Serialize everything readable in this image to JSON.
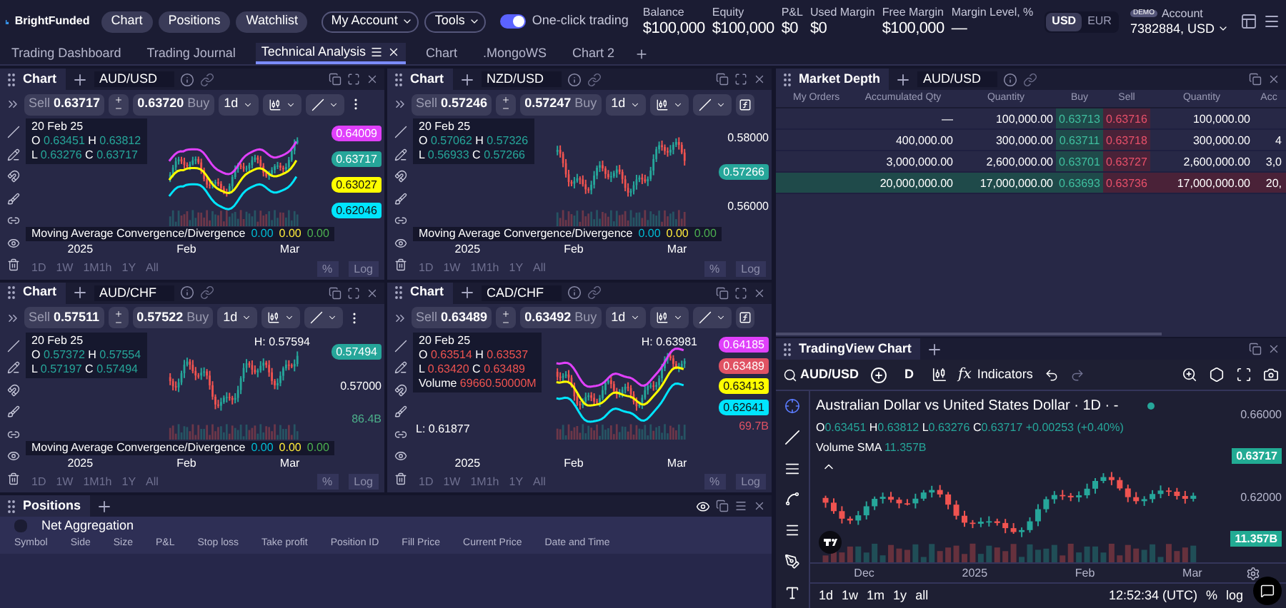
{
  "header": {
    "brand": "BrightFunded",
    "nav": [
      "Chart",
      "Positions",
      "Watchlist"
    ],
    "menus": [
      "My Account",
      "Tools"
    ],
    "toggle": {
      "label": "One-click trading",
      "on": true
    },
    "stats": [
      {
        "label": "Balance",
        "value": "$100,000"
      },
      {
        "label": "Equity",
        "value": "$100,000"
      },
      {
        "label": "P&L",
        "value": "$0"
      },
      {
        "label": "Used Margin",
        "value": "$0"
      },
      {
        "label": "Free Margin",
        "value": "$100,000"
      },
      {
        "label": "Margin Level, %",
        "value": "—"
      }
    ],
    "currencies": [
      {
        "label": "USD",
        "selected": true
      },
      {
        "label": "EUR",
        "selected": false
      }
    ],
    "account": {
      "badge": "DEMO",
      "label": "Account",
      "value": "7382884, USD"
    }
  },
  "tabs": [
    {
      "label": "Trading Dashboard",
      "selected": false
    },
    {
      "label": "Trading Journal",
      "selected": false
    },
    {
      "label": "Technical Analysis",
      "selected": true
    },
    {
      "label": "Chart",
      "selected": false
    },
    {
      "label": ".MongoWS",
      "selected": false
    },
    {
      "label": "Chart 2",
      "selected": false
    }
  ],
  "charts": [
    {
      "title": "Chart",
      "symbol": "AUD/USD",
      "sell_label": "Sell",
      "sell": "0.63717",
      "buy": "0.63720",
      "buy_label": "Buy",
      "interval": "1d",
      "end_button": {
        "kind": "more"
      },
      "date": "20 Feb 25",
      "bands": true,
      "ohlc": [
        {
          "key": "O",
          "value": "0.63451",
          "color": "#26a69a"
        },
        {
          "key": "H",
          "value": "0.63812",
          "color": "#26a69a"
        },
        {
          "key": "L",
          "value": "0.63276",
          "color": "#26a69a"
        },
        {
          "key": "C",
          "value": "0.63717",
          "color": "#26a69a"
        }
      ],
      "price_axis": [
        {
          "kind": "tag",
          "text": "0.64009",
          "color": "#e040fb"
        },
        {
          "kind": "tag",
          "text": "0.63717",
          "color": "#26a69a"
        },
        {
          "kind": "tag",
          "text": "0.63027",
          "color": "#ffff00"
        },
        {
          "kind": "tag",
          "text": "0.62046",
          "color": "#00e5ff"
        }
      ],
      "macd": {
        "label": "Moving Average Convergence/Divergence",
        "values": [
          {
            "text": "0.00",
            "color": "#00bcd4"
          },
          {
            "text": "0.00",
            "color": "#ffeb3b"
          },
          {
            "text": "0.00",
            "color": "#4caf50"
          }
        ]
      },
      "x_labels": [
        "2025",
        "Feb",
        "Mar"
      ],
      "ranges": [
        "1D",
        "1W",
        "1M1h",
        "1Y",
        "All"
      ],
      "scale": [
        "%",
        "Log"
      ]
    },
    {
      "title": "Chart",
      "symbol": "NZD/USD",
      "sell_label": "Sell",
      "sell": "0.57246",
      "buy": "0.57247",
      "buy_label": "Buy",
      "interval": "1d",
      "end_button": {
        "kind": "function"
      },
      "date": "20 Feb 25",
      "bands": false,
      "ohlc": [
        {
          "key": "O",
          "value": "0.57062",
          "color": "#26a69a"
        },
        {
          "key": "H",
          "value": "0.57326",
          "color": "#26a69a"
        },
        {
          "key": "L",
          "value": "0.56933",
          "color": "#26a69a"
        },
        {
          "key": "C",
          "value": "0.57266",
          "color": "#26a69a"
        }
      ],
      "price_axis": [
        {
          "kind": "tick",
          "text": "0.58000"
        },
        {
          "kind": "tag",
          "text": "0.57266",
          "color": "#26a69a"
        },
        {
          "kind": "tick",
          "text": "0.56000"
        }
      ],
      "macd": {
        "label": "Moving Average Convergence/Divergence",
        "values": [
          {
            "text": "0.00",
            "color": "#00bcd4"
          },
          {
            "text": "0.00",
            "color": "#ffeb3b"
          },
          {
            "text": "0.00",
            "color": "#4caf50"
          }
        ]
      },
      "x_labels": [
        "2025",
        "Feb",
        "Mar"
      ],
      "ranges": [
        "1D",
        "1W",
        "1M1h",
        "1Y",
        "All"
      ],
      "scale": [
        "%",
        "Log"
      ]
    },
    {
      "title": "Chart",
      "symbol": "AUD/CHF",
      "sell_label": "Sell",
      "sell": "0.57511",
      "buy": "0.57522",
      "buy_label": "Buy",
      "interval": "1d",
      "end_button": {
        "kind": "more"
      },
      "date": "20 Feb 25",
      "bands": false,
      "ohlc": [
        {
          "key": "O",
          "value": "0.57372",
          "color": "#26a69a"
        },
        {
          "key": "H",
          "value": "0.57554",
          "color": "#26a69a"
        },
        {
          "key": "L",
          "value": "0.57197",
          "color": "#26a69a"
        },
        {
          "key": "C",
          "value": "0.57494",
          "color": "#26a69a"
        }
      ],
      "price_axis": [
        {
          "kind": "tag",
          "text": "0.57494",
          "color": "#26a69a"
        },
        {
          "kind": "tick",
          "text": "0.57000"
        },
        {
          "kind": "volume",
          "text": "86.4B",
          "color": "#4caf8a"
        }
      ],
      "markers": [
        {
          "kind": "high",
          "text": "H: 0.57594"
        }
      ],
      "macd": {
        "label": "Moving Average Convergence/Divergence",
        "values": [
          {
            "text": "0.00",
            "color": "#00bcd4"
          },
          {
            "text": "0.00",
            "color": "#ffeb3b"
          },
          {
            "text": "0.00",
            "color": "#4caf50"
          }
        ]
      },
      "x_labels": [
        "2025",
        "Feb",
        "Mar"
      ],
      "ranges": [
        "1D",
        "1W",
        "1M1h",
        "1Y",
        "All"
      ],
      "scale": [
        "%",
        "Log"
      ]
    },
    {
      "title": "Chart",
      "symbol": "CAD/CHF",
      "sell_label": "Sell",
      "sell": "0.63489",
      "buy": "0.63492",
      "buy_label": "Buy",
      "interval": "1d",
      "end_button": {
        "kind": "function"
      },
      "date": "20 Feb 25",
      "bands": true,
      "ohlc": [
        {
          "key": "O",
          "value": "0.63514",
          "color": "#ef5350"
        },
        {
          "key": "H",
          "value": "0.63537",
          "color": "#ef5350"
        },
        {
          "key": "L",
          "value": "0.63420",
          "color": "#ef5350"
        },
        {
          "key": "C",
          "value": "0.63489",
          "color": "#ef5350"
        }
      ],
      "volume": {
        "label": "Volume",
        "value": "69660.50000M",
        "color": "#ef5350"
      },
      "price_axis": [
        {
          "kind": "tag",
          "text": "0.64185",
          "color": "#e040fb"
        },
        {
          "kind": "tag",
          "text": "0.63489",
          "color": "#e05263"
        },
        {
          "kind": "tag",
          "text": "0.63413",
          "color": "#ffff00"
        },
        {
          "kind": "tag",
          "text": "0.62641",
          "color": "#00e5ff"
        },
        {
          "kind": "volume",
          "text": "69.7B",
          "color": "#e05263"
        }
      ],
      "markers": [
        {
          "kind": "high",
          "text": "H: 0.63981"
        },
        {
          "kind": "low",
          "text": "L: 0.61877"
        }
      ],
      "x_labels": [
        "2025",
        "Feb",
        "Mar"
      ],
      "ranges": [
        "1D",
        "1W",
        "1M1h",
        "1Y",
        "All"
      ],
      "scale": [
        "%",
        "Log"
      ]
    }
  ],
  "market_depth": {
    "title": "Market Depth",
    "symbol": "AUD/USD",
    "columns": [
      "My Orders",
      "Accumulated Qty",
      "Quantity",
      "Buy",
      "Sell",
      "Quantity",
      "Acc"
    ],
    "rows": [
      {
        "cells": [
          "",
          "—",
          "100,000.00",
          "0.63713",
          "0.63716",
          "100,000.00",
          ""
        ],
        "highlighted": false
      },
      {
        "cells": [
          "",
          "400,000.00",
          "300,000.00",
          "0.63711",
          "0.63718",
          "300,000.00",
          "4"
        ],
        "highlighted": false
      },
      {
        "cells": [
          "",
          "3,000,000.00",
          "2,600,000.00",
          "0.63701",
          "0.63727",
          "2,600,000.00",
          "3,0"
        ],
        "highlighted": false
      },
      {
        "cells": [
          "",
          "20,000,000.00",
          "17,000,000.00",
          "0.63693",
          "0.63736",
          "17,000,000.00",
          "20,"
        ],
        "highlighted": true
      }
    ]
  },
  "tradingview": {
    "title": "TradingView Chart",
    "symbol": "AUD/USD",
    "interval": "D",
    "function_symbol": "fx",
    "indicators": "Indicators",
    "legend_title": "Australian Dollar vs United States Dollar · 1D · -",
    "ohlc": [
      {
        "key": "O",
        "value": "0.63451"
      },
      {
        "key": "H",
        "value": "0.63812"
      },
      {
        "key": "L",
        "value": "0.63276"
      },
      {
        "key": "C",
        "value": "0.63717"
      }
    ],
    "change": "+0.00253 (+0.40%)",
    "volume_label": "Volume SMA",
    "volume_value": "11.357B",
    "price_axis": [
      {
        "kind": "tick",
        "text": "0.66000"
      },
      {
        "kind": "tag",
        "text": "0.63717",
        "color": "#22ab94"
      },
      {
        "kind": "tick",
        "text": "0.62000"
      },
      {
        "kind": "tag",
        "text": "11.357B",
        "color": "#22ab94"
      }
    ],
    "x_labels": [
      "Dec",
      "2025",
      "Feb",
      "Mar"
    ],
    "ranges": [
      "1d",
      "1w",
      "1m",
      "1y",
      "all"
    ],
    "time": "12:52:34 (UTC)",
    "scale": [
      "%",
      "log"
    ]
  },
  "positions": {
    "title": "Positions",
    "net": {
      "label": "Net Aggregation",
      "checked": false
    },
    "columns": [
      "Symbol",
      "Side",
      "Size",
      "P&L",
      "Stop loss",
      "Take profit",
      "Position ID",
      "Fill Price",
      "Current Price",
      "Date and Time"
    ]
  }
}
